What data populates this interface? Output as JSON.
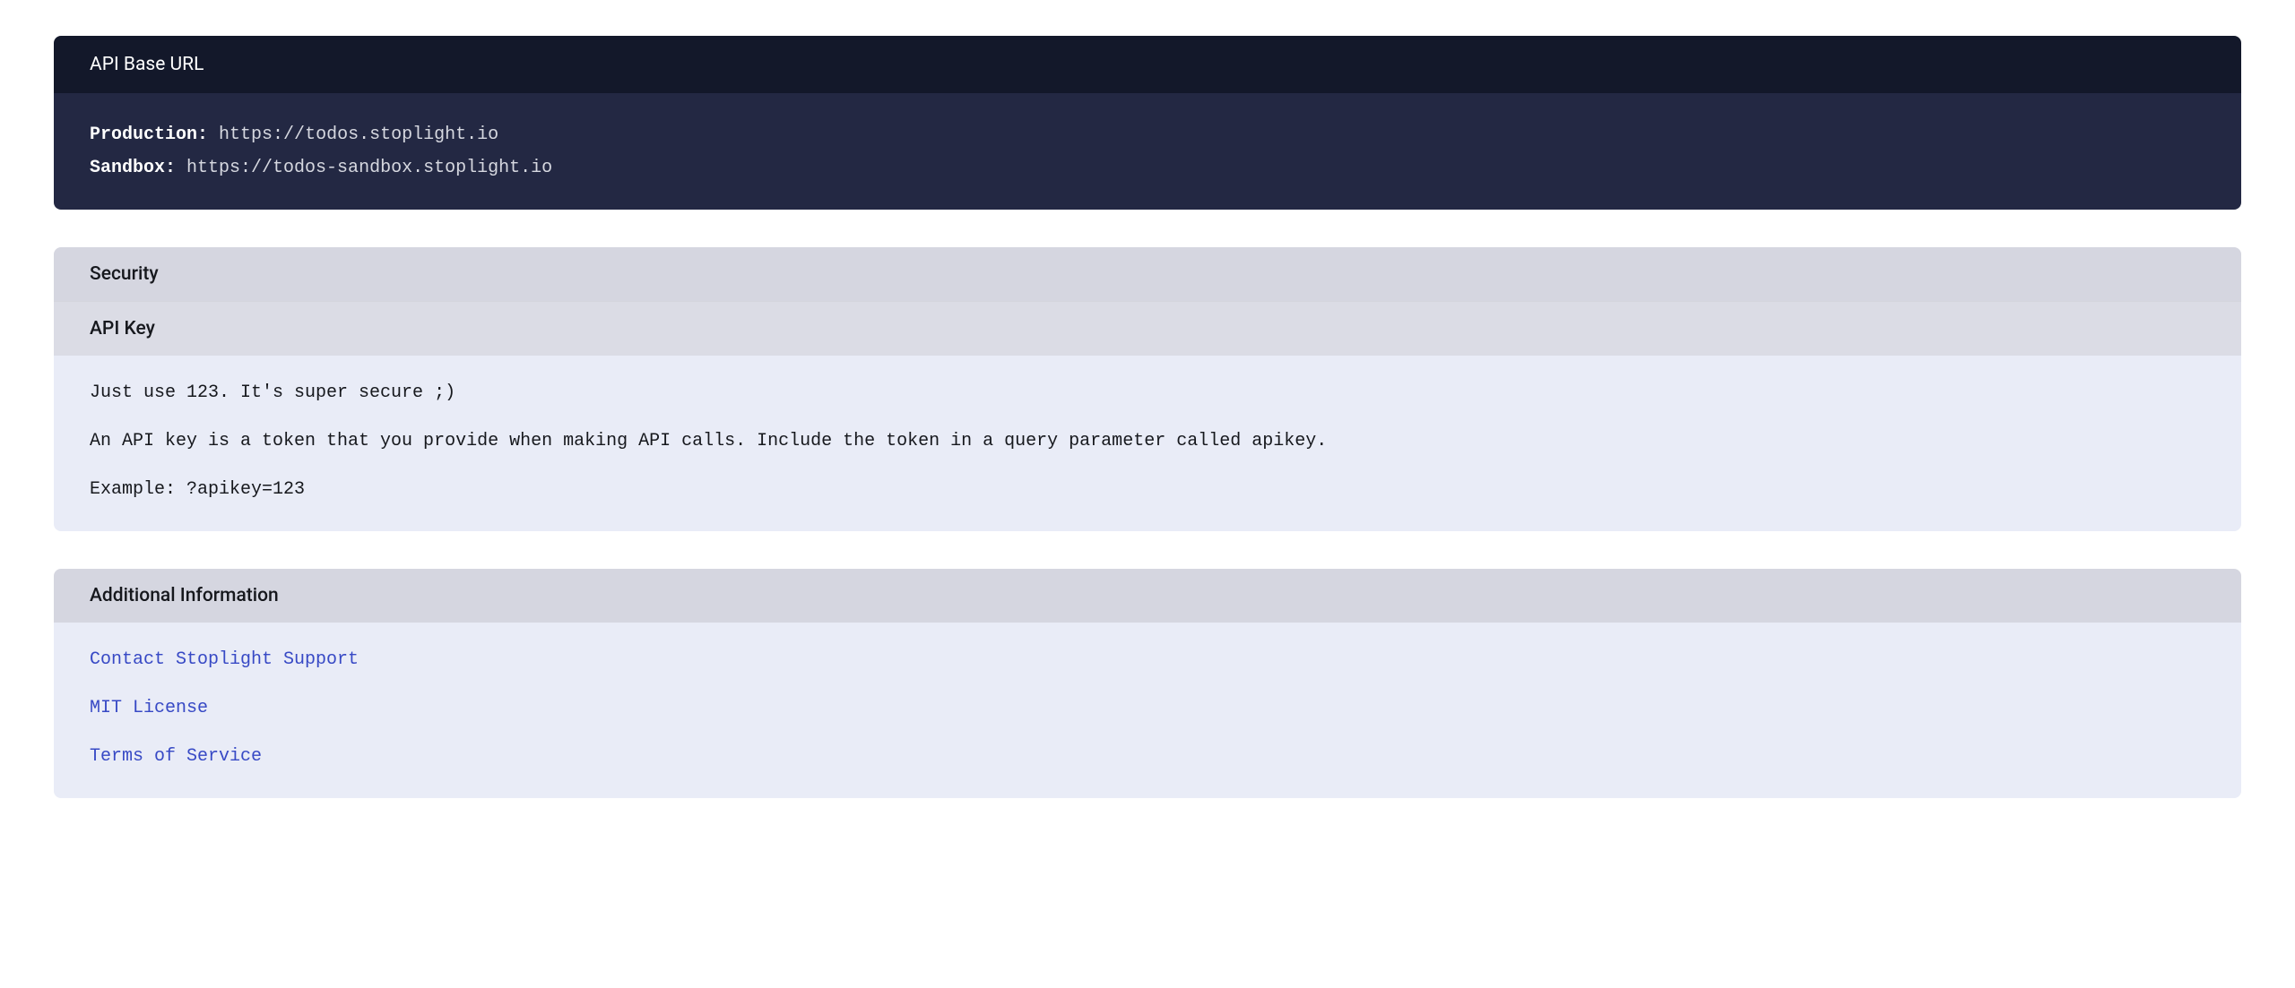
{
  "api_base_url": {
    "header": "API Base URL",
    "servers": [
      {
        "label": "Production:",
        "url": "https://todos.stoplight.io"
      },
      {
        "label": "Sandbox:",
        "url": "https://todos-sandbox.stoplight.io"
      }
    ]
  },
  "security": {
    "header": "Security",
    "subheader": "API Key",
    "lines": [
      "Just use 123. It's super secure ;)",
      "An API key is a token that you provide when making API calls. Include the token in a query parameter called apikey.",
      "Example: ?apikey=123"
    ]
  },
  "additional": {
    "header": "Additional Information",
    "links": [
      "Contact Stoplight Support",
      "MIT License",
      "Terms of Service"
    ]
  }
}
